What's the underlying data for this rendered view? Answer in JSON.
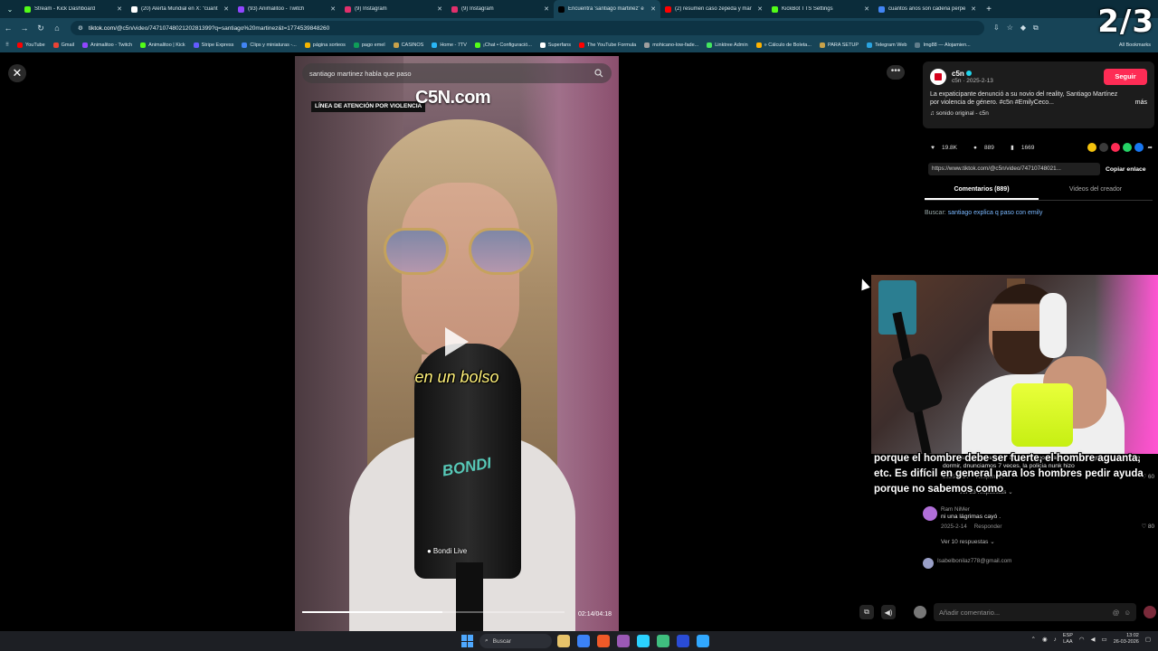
{
  "overlay": {
    "page_counter": "2/3"
  },
  "tabs": [
    {
      "label": "Stream - Kick Dashboard",
      "color": "#53fc18",
      "active": false
    },
    {
      "label": "(20) Alerta Mundial en X: \"cuant",
      "color": "#ffffff",
      "active": false
    },
    {
      "label": "(93) Animalitoo - Twitch",
      "color": "#9146ff",
      "active": false
    },
    {
      "label": "(9) Instagram",
      "color": "#e1306c",
      "active": false
    },
    {
      "label": "(9) Instagram",
      "color": "#e1306c",
      "active": false
    },
    {
      "label": "Encuentra 'santiago martinez' e",
      "color": "#000000",
      "active": true
    },
    {
      "label": "(2) resumen caso zepeda y mar",
      "color": "#ff0000",
      "active": false
    },
    {
      "label": "KickBot TTS Settings",
      "color": "#53fc18",
      "active": false
    },
    {
      "label": "cuantos años son cadena perpe",
      "color": "#4285f4",
      "active": false
    }
  ],
  "address": {
    "url_domain": "tiktok.com",
    "url_path": "/@c5n/video/7471074802120281399?q=santiago%20martinez&t=1774539848260"
  },
  "bookmarks": [
    {
      "label": "YouTube",
      "color": "#ff0000"
    },
    {
      "label": "Gmail",
      "color": "#ea4335"
    },
    {
      "label": "Animalitoo - Twitch",
      "color": "#9146ff"
    },
    {
      "label": "Animalitoo | Kick",
      "color": "#53fc18"
    },
    {
      "label": "Stripe Express",
      "color": "#635bff"
    },
    {
      "label": "Clips y miniaturas -...",
      "color": "#4285f4"
    },
    {
      "label": "página sorteos",
      "color": "#f4b400"
    },
    {
      "label": "pago emel",
      "color": "#0f9d58"
    },
    {
      "label": "CASINOS",
      "color": "#c8a24a"
    },
    {
      "label": "Home - 7TV",
      "color": "#29b6f6"
    },
    {
      "label": "¡Chat • Configuració...",
      "color": "#53fc18"
    },
    {
      "label": "Superfans",
      "color": "#ffffff"
    },
    {
      "label": "The YouTube Formula",
      "color": "#ff0000"
    },
    {
      "label": "mohicano-low-fade...",
      "color": "#9e9e9e"
    },
    {
      "label": "Linktree Admin",
      "color": "#43e660"
    },
    {
      "label": "» Cálculo de Boleta...",
      "color": "#ffb300"
    },
    {
      "label": "PARA SETUP",
      "color": "#c8a24a"
    },
    {
      "label": "Telegram Web",
      "color": "#2aa3e0"
    },
    {
      "label": "Img88 — Alojamien...",
      "color": "#607d8b"
    }
  ],
  "bookmarks_all": "All Bookmarks",
  "video": {
    "search_query": "santiago martinez habla que paso",
    "linea_banner": "LÍNEA DE ATENCIÓN POR VIOLENCIA",
    "brand": "C5N.com",
    "subtitle": "en un bolso",
    "mic_logo": "BONDI",
    "watermark": "Bondi Live",
    "time": "02:14/04:18",
    "progress": 0.536
  },
  "post": {
    "author": "c5n",
    "meta": "c5n · 2025-2-13",
    "follow": "Seguir",
    "description": "La expaticipante denunció a su novio del reality, Santiago Martínez por violencia de género. #c5n #EmilyCeco...",
    "more": "más",
    "sound": "sonido original - c5n",
    "likes": "19.8K",
    "comments": "889",
    "saves": "1669",
    "link": "https://www.tiktok.com/@c5n/video/74710748021...",
    "copy_link": "Copiar enlace",
    "share_colors": [
      "#f4c20d",
      "#3a3a3a",
      "#fe2c55",
      "#25d366",
      "#1877f2"
    ]
  },
  "panel_tabs": [
    {
      "label": "Comentarios (889)",
      "on": true
    },
    {
      "label": "Videos del creador",
      "on": false
    }
  ],
  "search_hint": {
    "prefix": "Buscar:",
    "link": "santiago explica q paso con emily"
  },
  "comments": {
    "first": {
      "text": "permitanme tener mis dudas el ester relato ,mi hermanita la mato marido , pero ella no podia parar llorar , se mojaba con tantas lagrimas , no podia dormir, dnunciamos 7 veces. la policia nunk hizo",
      "date": "2025-2-14",
      "reply": "Responder",
      "likes": "60",
      "replies": "Ver 23 respuestas"
    },
    "second": {
      "user": "Ram NiMer",
      "text": "ni una lágrimas cayó .",
      "date": "2025-2-14",
      "reply": "Responder",
      "likes": "80",
      "replies": "Ver 10 respuestas",
      "avatar_color": "#b06fd8"
    },
    "third": {
      "user": "Isabelbonilaz778@gmail.com",
      "avatar_color": "#9aa0c8"
    }
  },
  "comment_bar": {
    "placeholder": "Añadir comentario..."
  },
  "caption": "porque el hombre debe ser fuerte, el hombre aguanta, etc. Es difícil en general para los hombres pedir ayuda porque no sabemos como",
  "taskbar": {
    "search": "Buscar",
    "lang_top": "ESP",
    "lang_bottom": "LAA",
    "time": "13:02",
    "date": "26-03-2026",
    "apps": [
      "#e7c36a",
      "#3b82f6",
      "#f05a28",
      "#9b59b6",
      "#2bd2ff",
      "#3fbf7f",
      "#2a4cd6",
      "#31a8ff"
    ]
  }
}
